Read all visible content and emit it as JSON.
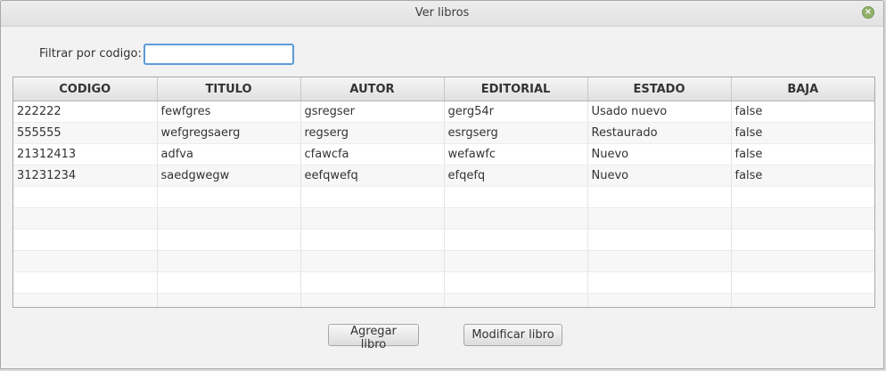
{
  "window": {
    "title": "Ver libros",
    "close_glyph": "×"
  },
  "filter": {
    "label": "Filtrar por codigo:",
    "value": ""
  },
  "table": {
    "columns": [
      "CODIGO",
      "TITULO",
      "AUTOR",
      "EDITORIAL",
      "ESTADO",
      "BAJA"
    ],
    "rows": [
      [
        "222222",
        "fewfgres",
        "gsregser",
        "gerg54r",
        "Usado nuevo",
        "false"
      ],
      [
        "555555",
        "wefgregsaerg",
        "regserg",
        "esrgserg",
        "Restaurado",
        "false"
      ],
      [
        "21312413",
        "adfva",
        "cfawcfa",
        "wefawfc",
        "Nuevo",
        "false"
      ],
      [
        "31231234",
        "saedgwegw",
        "eefqwefq",
        "efqefq",
        "Nuevo",
        "false"
      ]
    ]
  },
  "buttons": {
    "add_label": "Agregar libro",
    "modify_label": "Modificar libro"
  }
}
